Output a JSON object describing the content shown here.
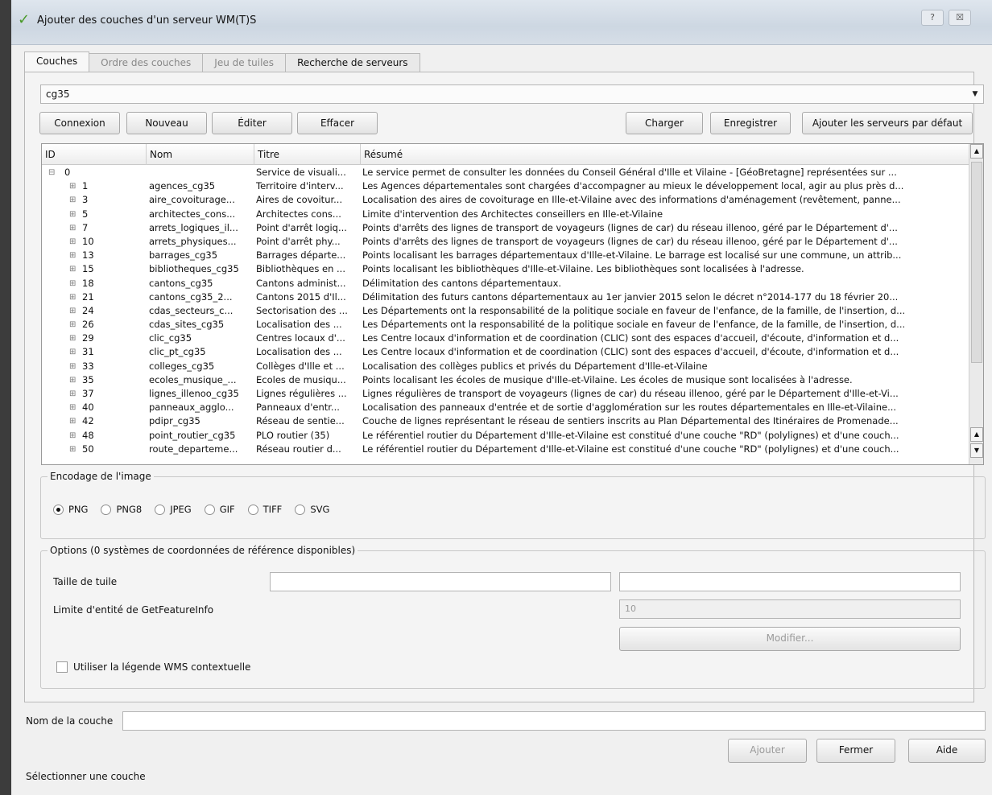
{
  "window": {
    "title": "Ajouter des couches d'un serveur WM(T)S",
    "help_glyph": "?",
    "close_glyph": "☒"
  },
  "tabs": [
    {
      "label": "Couches",
      "active": true
    },
    {
      "label": "Ordre des couches",
      "active": false
    },
    {
      "label": "Jeu de tuiles",
      "active": false
    },
    {
      "label": "Recherche de serveurs",
      "active": false
    }
  ],
  "connection": {
    "selected": "cg35"
  },
  "buttons": {
    "connexion": "Connexion",
    "nouveau": "Nouveau",
    "editer": "Éditer",
    "effacer": "Effacer",
    "charger": "Charger",
    "enregistrer": "Enregistrer",
    "ajouter_serveurs": "Ajouter les serveurs par défaut",
    "ajouter": "Ajouter",
    "fermer": "Fermer",
    "aide": "Aide",
    "modifier": "Modifier..."
  },
  "layers_table": {
    "headers": {
      "id": "ID",
      "nom": "Nom",
      "titre": "Titre",
      "resume": "Résumé"
    },
    "root": {
      "id": "0",
      "nom": "",
      "titre": "Service de visuali...",
      "resume": "Le service permet de consulter les données du Conseil Général d'Ille et Vilaine - [GéoBretagne] représentées sur ..."
    },
    "rows": [
      {
        "id": "1",
        "nom": "agences_cg35",
        "titre": "Territoire d'interv...",
        "resume": "Les Agences départementales sont chargées d'accompagner au mieux le développement local, agir au plus près d..."
      },
      {
        "id": "3",
        "nom": "aire_covoiturage...",
        "titre": "Aires de covoitur...",
        "resume": "Localisation des aires de covoiturage en Ille-et-Vilaine avec des informations d'aménagement (revêtement, panne..."
      },
      {
        "id": "5",
        "nom": "architectes_cons...",
        "titre": "Architectes cons...",
        "resume": "Limite d'intervention des Architectes conseillers en Ille-et-Vilaine"
      },
      {
        "id": "7",
        "nom": "arrets_logiques_il...",
        "titre": "Point d'arrêt logiq...",
        "resume": "Points d'arrêts des lignes de transport de voyageurs (lignes de car) du réseau illenoo, géré par le Département d'..."
      },
      {
        "id": "10",
        "nom": "arrets_physiques...",
        "titre": "Point d'arrêt phy...",
        "resume": "Points d'arrêts des lignes de transport de voyageurs (lignes de car) du réseau illenoo, géré par le Département d'..."
      },
      {
        "id": "13",
        "nom": "barrages_cg35",
        "titre": "Barrages départe...",
        "resume": "Points localisant les barrages départementaux d'Ille-et-Vilaine. Le barrage est localisé sur une commune, un attrib..."
      },
      {
        "id": "15",
        "nom": "bibliotheques_cg35",
        "titre": "Bibliothèques en ...",
        "resume": "Points localisant les bibliothèques d'Ille-et-Vilaine. Les bibliothèques sont localisées à l'adresse."
      },
      {
        "id": "18",
        "nom": "cantons_cg35",
        "titre": "Cantons administ...",
        "resume": "Délimitation des cantons départementaux."
      },
      {
        "id": "21",
        "nom": "cantons_cg35_2...",
        "titre": "Cantons 2015 d'Il...",
        "resume": "Délimitation des futurs cantons départementaux au 1er janvier 2015 selon le décret n°2014-177 du 18 février 20..."
      },
      {
        "id": "24",
        "nom": "cdas_secteurs_c...",
        "titre": "Sectorisation des ...",
        "resume": "Les Départements ont la responsabilité de la politique sociale en faveur de l'enfance, de la famille, de l'insertion, d..."
      },
      {
        "id": "26",
        "nom": "cdas_sites_cg35",
        "titre": "Localisation des ...",
        "resume": "Les Départements ont la responsabilité de la politique sociale en faveur de l'enfance, de la famille, de l'insertion, d..."
      },
      {
        "id": "29",
        "nom": "clic_cg35",
        "titre": "Centres locaux d'...",
        "resume": "Les Centre locaux d'information et de coordination (CLIC) sont des espaces d'accueil, d'écoute, d'information et d..."
      },
      {
        "id": "31",
        "nom": "clic_pt_cg35",
        "titre": "Localisation des ...",
        "resume": "Les Centre locaux d'information et de coordination (CLIC) sont des espaces d'accueil, d'écoute, d'information et d..."
      },
      {
        "id": "33",
        "nom": "colleges_cg35",
        "titre": "Collèges d'Ille et ...",
        "resume": "Localisation des collèges publics et privés du Département d'Ille-et-Vilaine"
      },
      {
        "id": "35",
        "nom": "ecoles_musique_...",
        "titre": "Ecoles de musiqu...",
        "resume": "Points localisant les écoles de musique d'Ille-et-Vilaine. Les écoles de musique sont localisées à l'adresse."
      },
      {
        "id": "37",
        "nom": "lignes_illenoo_cg35",
        "titre": "Lignes régulières ...",
        "resume": "Lignes régulières de transport de voyageurs (lignes de car) du réseau illenoo, géré par le Département d'Ille-et-Vi..."
      },
      {
        "id": "40",
        "nom": "panneaux_agglo...",
        "titre": "Panneaux d'entr...",
        "resume": "Localisation des panneaux d'entrée et de sortie d'agglomération sur les routes départementales en Ille-et-Vilaine..."
      },
      {
        "id": "42",
        "nom": "pdipr_cg35",
        "titre": "Réseau de sentie...",
        "resume": "Couche de lignes représentant le réseau de sentiers inscrits au Plan Départemental des Itinéraires de Promenade..."
      },
      {
        "id": "48",
        "nom": "point_routier_cg35",
        "titre": "PLO routier (35)",
        "resume": "Le référentiel routier du Département d'Ille-et-Vilaine est constitué d'une couche \"RD\" (polylignes) et d'une couch..."
      },
      {
        "id": "50",
        "nom": "route_departeme...",
        "titre": "Réseau routier d...",
        "resume": "Le référentiel routier du Département d'Ille-et-Vilaine est constitué d'une couche \"RD\" (polylignes) et d'une couch..."
      }
    ]
  },
  "encoding": {
    "title": "Encodage de l'image",
    "options": [
      {
        "label": "PNG",
        "selected": true
      },
      {
        "label": "PNG8",
        "selected": false
      },
      {
        "label": "JPEG",
        "selected": false
      },
      {
        "label": "GIF",
        "selected": false
      },
      {
        "label": "TIFF",
        "selected": false
      },
      {
        "label": "SVG",
        "selected": false
      }
    ]
  },
  "options": {
    "title": "Options (0 systèmes de coordonnées de référence disponibles)",
    "tile_size_label": "Taille de tuile",
    "tile_width_value": "",
    "tile_height_value": "",
    "feature_limit_label": "Limite d'entité de GetFeatureInfo",
    "feature_limit_value": "10",
    "contextual_legend_label": "Utiliser la légende WMS contextuelle",
    "contextual_legend_checked": false
  },
  "layer_name": {
    "label": "Nom de la couche",
    "value": ""
  },
  "status": "Sélectionner une couche"
}
